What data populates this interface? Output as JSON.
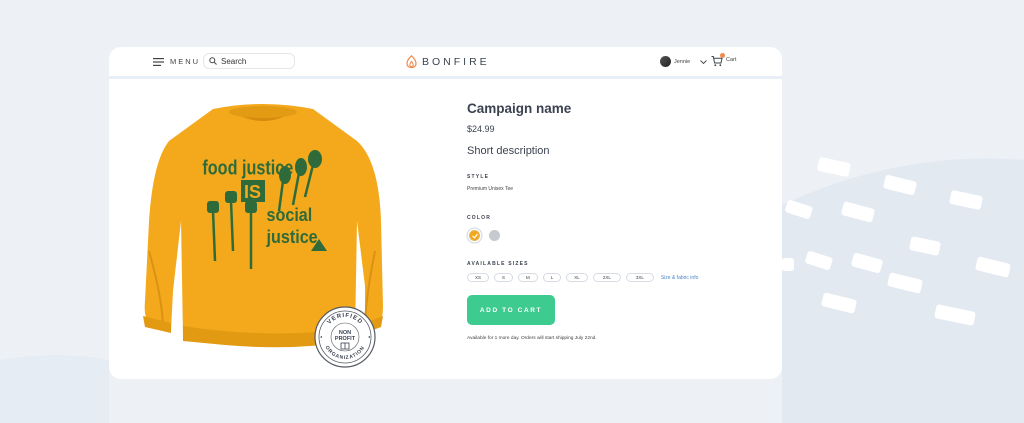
{
  "header": {
    "menu_label": "MENU",
    "search_placeholder": "Search",
    "logo_text": "BONFIRE",
    "user_name": "Jennie",
    "cart_label": "Cart"
  },
  "product": {
    "title": "Campaign name",
    "price": "$24.99",
    "short_description": "Short description",
    "style_label": "STYLE",
    "style_value": "Premium Unisex Tee",
    "color_label": "COLOR",
    "colors": [
      {
        "name": "gold",
        "hex": "#f4a91c",
        "selected": true
      },
      {
        "name": "gray",
        "hex": "#c6c9cd",
        "selected": false
      }
    ],
    "sizes_label": "AVAILABLE SIZES",
    "sizes": [
      "XS",
      "S",
      "M",
      "L",
      "XL",
      "2XL",
      "3XL"
    ],
    "size_info_link": "Size & fabric info",
    "add_to_cart_label": "ADD TO CART",
    "availability_note": "Available for 1 more day. Orders will start shipping July 22nd."
  },
  "shirt_print": {
    "line1": "food justice",
    "line2": "IS",
    "line3": "social",
    "line4": "justice"
  },
  "badge": {
    "top_text": "VERIFIED",
    "middle_text_1": "NON",
    "middle_text_2": "PROFIT",
    "bottom_text": "ORGANIZATION"
  },
  "colors": {
    "accent_green": "#3ecb8f",
    "sweater": "#f4a91c",
    "print_green": "#2f6b3a",
    "link_blue": "#4a87c8"
  }
}
